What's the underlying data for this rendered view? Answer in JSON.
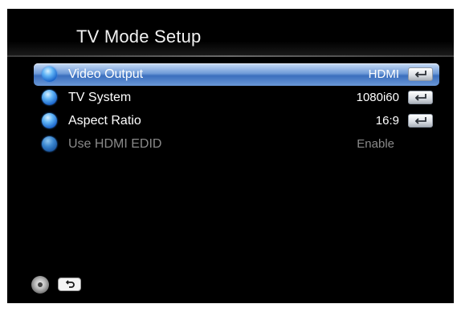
{
  "header": {
    "title": "TV Mode Setup"
  },
  "menu": {
    "items": [
      {
        "label": "Video Output",
        "value": "HDMI",
        "selected": true,
        "enabled": true,
        "icon": "enter-key-icon"
      },
      {
        "label": "TV System",
        "value": "1080i60",
        "selected": false,
        "enabled": true,
        "icon": "enter-key-icon"
      },
      {
        "label": "Aspect Ratio",
        "value": "16:9",
        "selected": false,
        "enabled": true,
        "icon": "enter-key-icon"
      },
      {
        "label": "Use HDMI EDID",
        "value": "Enable",
        "selected": false,
        "enabled": false
      }
    ]
  },
  "footer": {
    "nav_icon": "remote-dpad-icon",
    "back_icon": "back-key-icon"
  },
  "colors": {
    "background": "#000000",
    "selection_highlight": "#6f9bd8",
    "text": "#ffffff",
    "disabled_text": "#8a8a8a",
    "bullet": "#1a63c9"
  }
}
